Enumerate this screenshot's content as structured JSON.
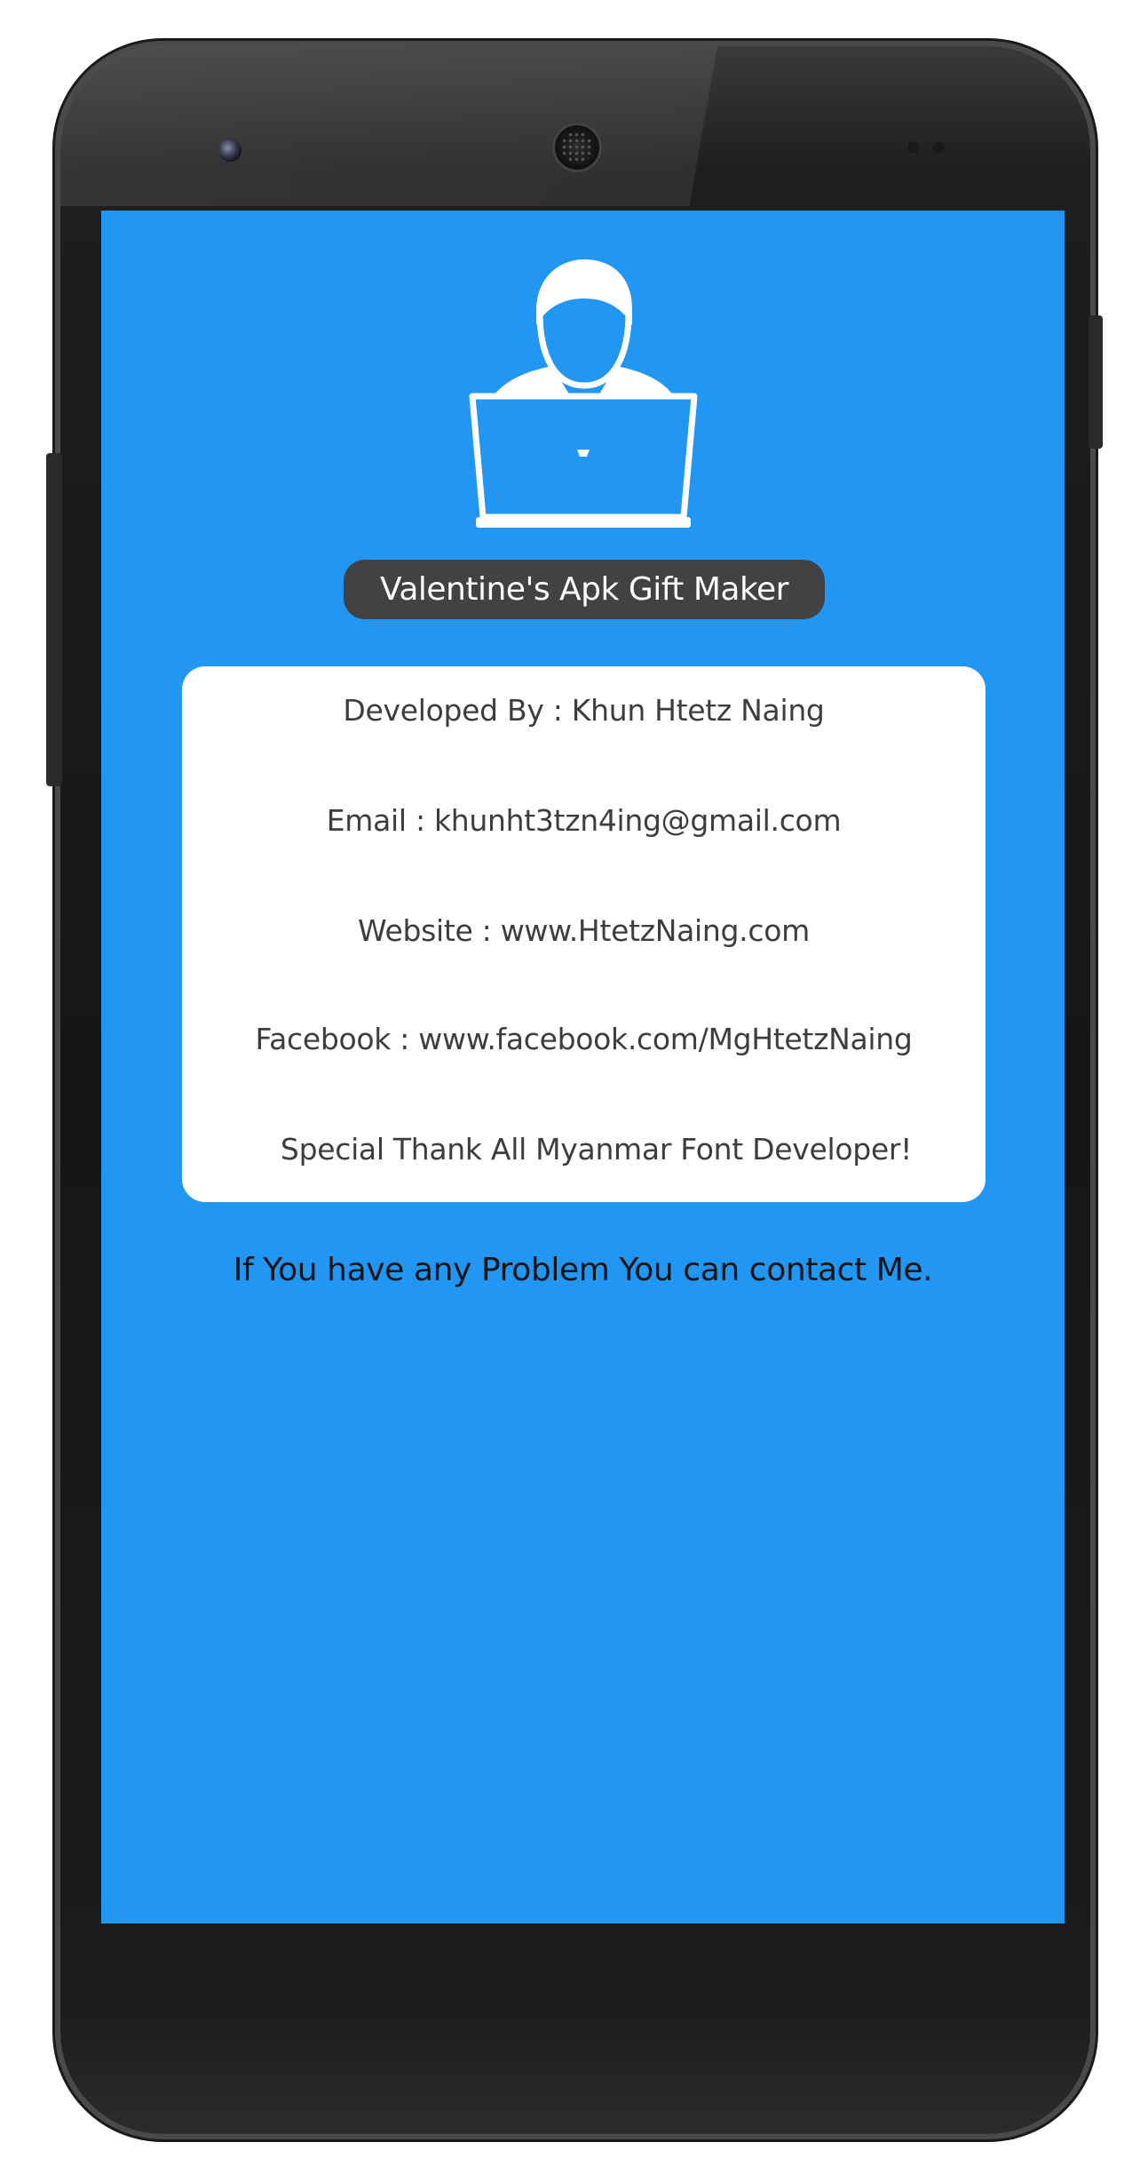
{
  "app": {
    "title": "Valentine's Apk Gift Maker",
    "accent_color": "#2196f3",
    "title_pill_color": "#424242"
  },
  "device": {
    "front_camera_icon": "camera-icon",
    "speaker_icon": "speaker-grille-icon"
  },
  "header": {
    "avatar_icon": "developer-at-laptop-icon"
  },
  "info": {
    "developed_by": "Developed By : Khun Htetz Naing",
    "email": "Email : khunht3tzn4ing@gmail.com",
    "website": "Website : www.HtetzNaing.com",
    "facebook": "Facebook : www.facebook.com/MgHtetzNaing",
    "thanks": "Special Thank All Myanmar Font Developer!"
  },
  "footer": {
    "contact_text": "If You have any Problem You can contact Me."
  }
}
